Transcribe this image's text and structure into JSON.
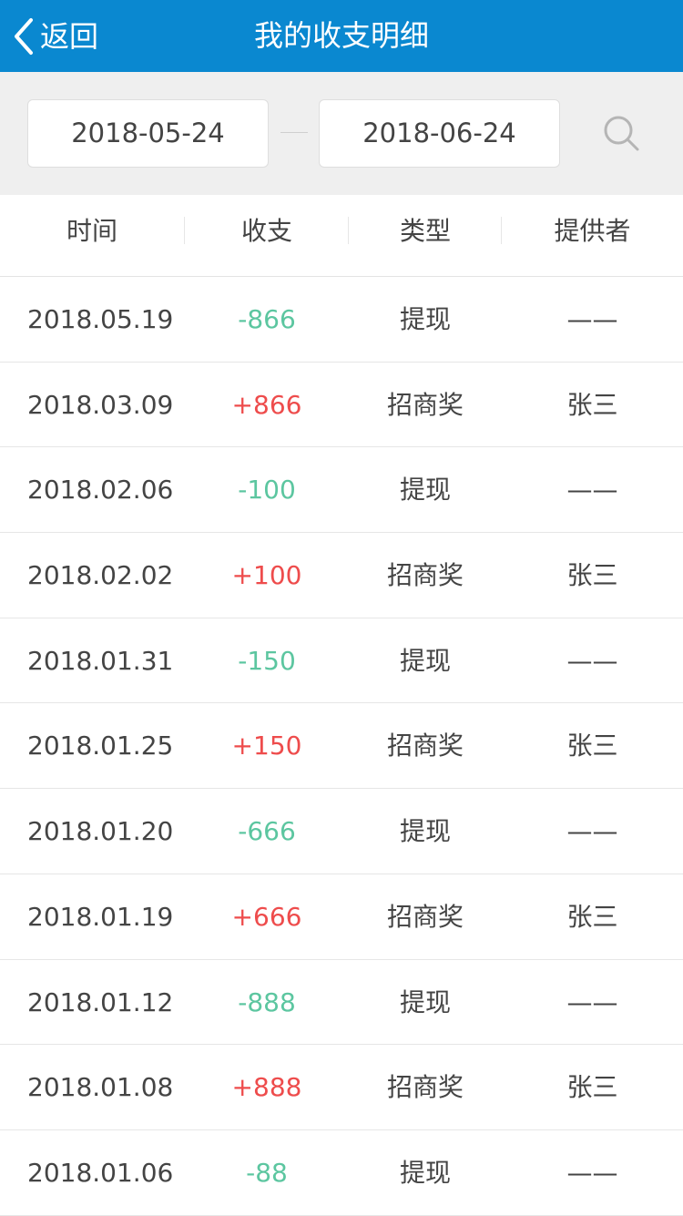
{
  "header": {
    "back_label": "返回",
    "title": "我的收支明细"
  },
  "filter": {
    "start_date": "2018-05-24",
    "end_date": "2018-06-24"
  },
  "table": {
    "headers": [
      "时间",
      "收支",
      "类型",
      "提供者"
    ],
    "rows": [
      {
        "date": "2018.05.19",
        "amount": "-866",
        "type": "提现",
        "provider": "——"
      },
      {
        "date": "2018.03.09",
        "amount": "+866",
        "type": "招商奖",
        "provider": "张三"
      },
      {
        "date": "2018.02.06",
        "amount": "-100",
        "type": "提现",
        "provider": "——"
      },
      {
        "date": "2018.02.02",
        "amount": "+100",
        "type": "招商奖",
        "provider": "张三"
      },
      {
        "date": "2018.01.31",
        "amount": "-150",
        "type": "提现",
        "provider": "——"
      },
      {
        "date": "2018.01.25",
        "amount": "+150",
        "type": "招商奖",
        "provider": "张三"
      },
      {
        "date": "2018.01.20",
        "amount": "-666",
        "type": "提现",
        "provider": "——"
      },
      {
        "date": "2018.01.19",
        "amount": "+666",
        "type": "招商奖",
        "provider": "张三"
      },
      {
        "date": "2018.01.12",
        "amount": "-888",
        "type": "提现",
        "provider": "——"
      },
      {
        "date": "2018.01.08",
        "amount": "+888",
        "type": "招商奖",
        "provider": "张三"
      },
      {
        "date": "2018.01.06",
        "amount": "-88",
        "type": "提现",
        "provider": "——"
      }
    ]
  },
  "colors": {
    "header_bg": "#0a88d0",
    "expense": "#5cc6a0",
    "income": "#ee4c4c"
  }
}
